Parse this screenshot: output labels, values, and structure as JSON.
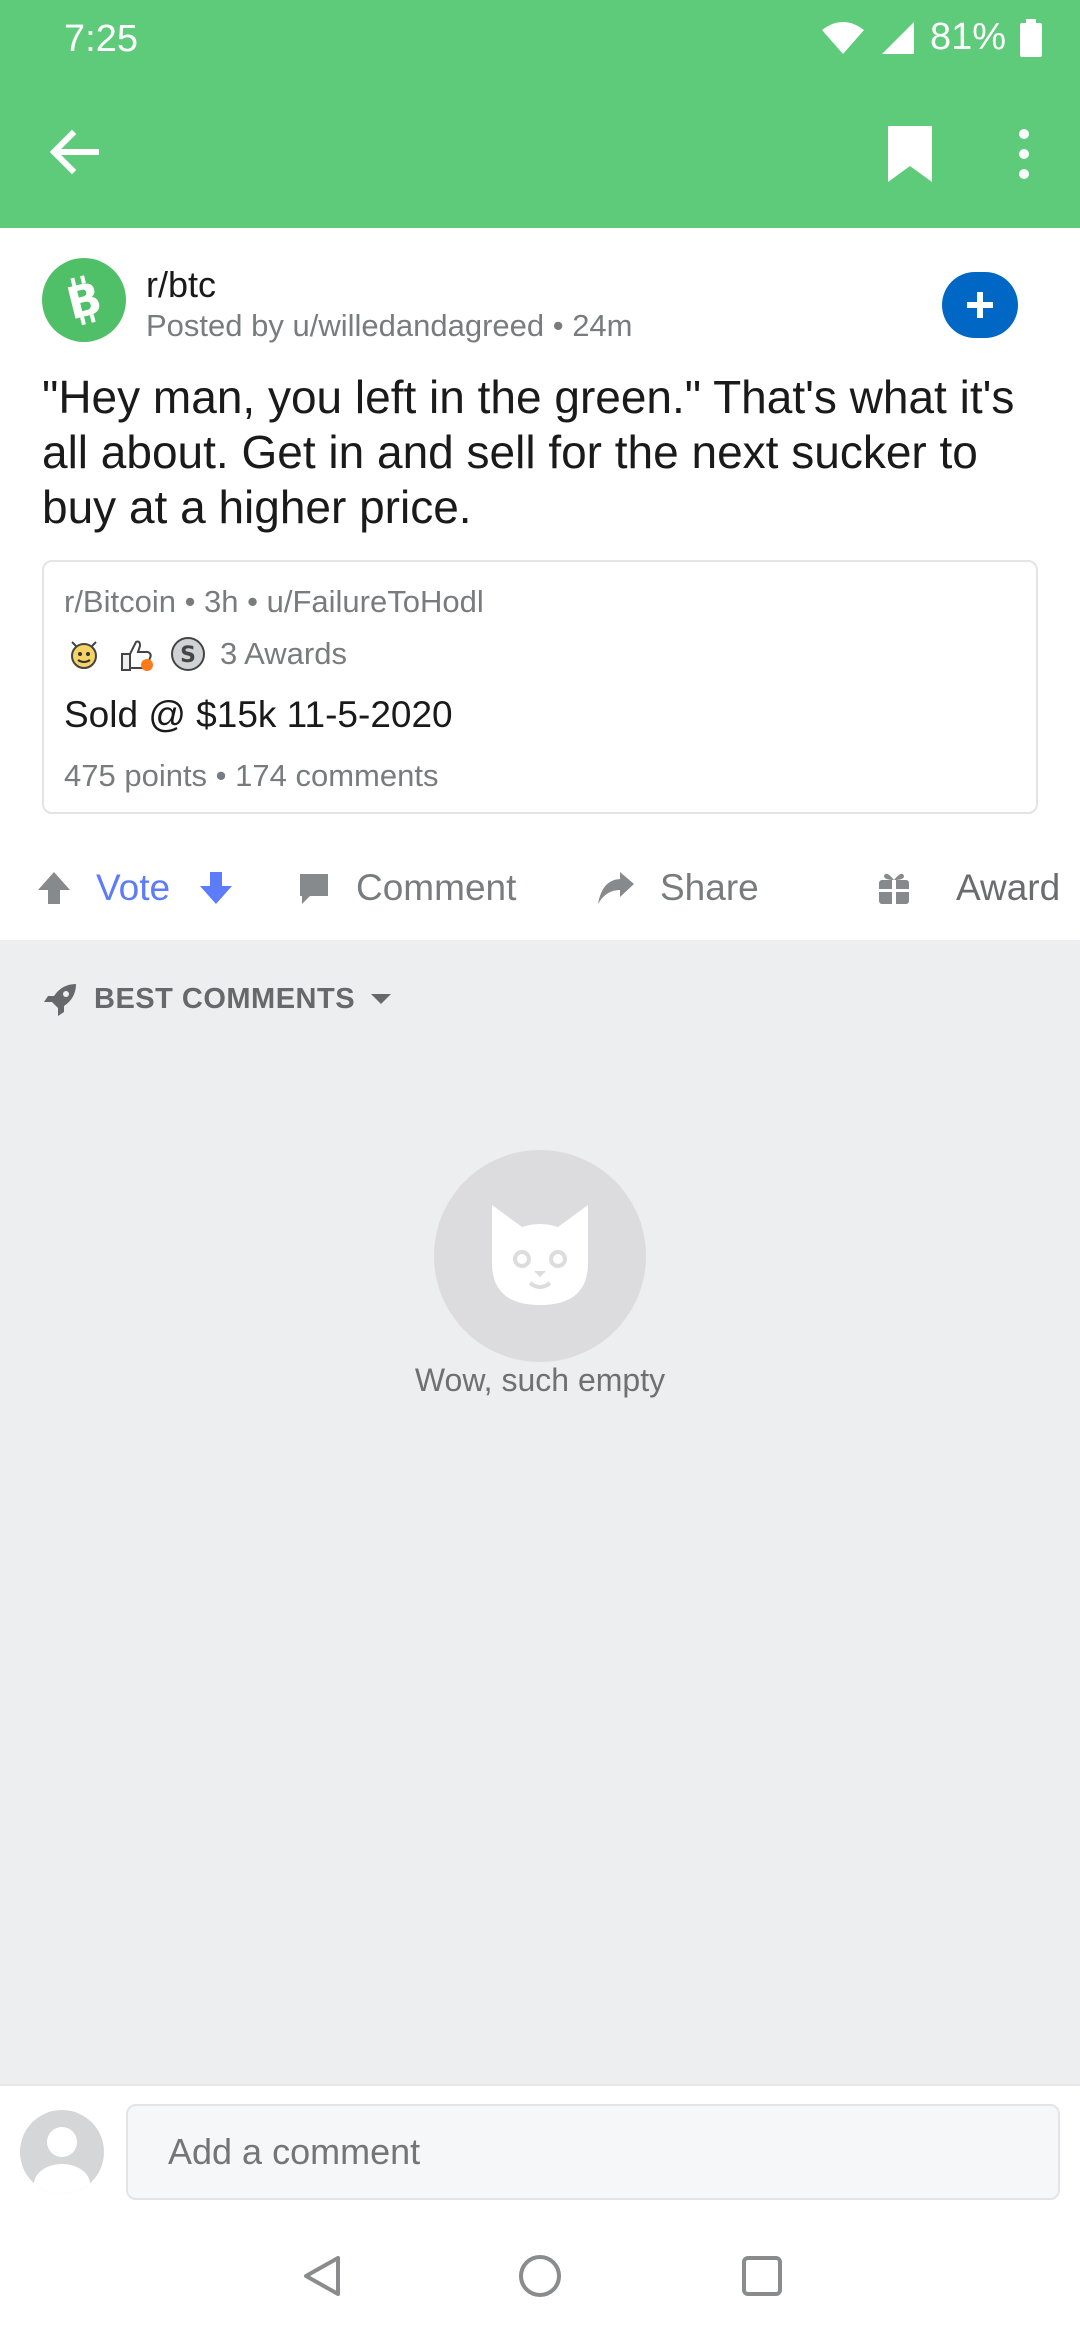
{
  "status": {
    "time": "7:25",
    "battery": "81%"
  },
  "post": {
    "subreddit": "r/btc",
    "posted_by": "Posted by u/willedandagreed • 24m",
    "title": "\"Hey man, you left in the green.\" That's what it's all about. Get in and sell for the next sucker to buy at a higher price.",
    "crosspost": {
      "meta": "r/Bitcoin • 3h • u/FailureToHodl",
      "awards_label": "3 Awards",
      "title": "Sold @ $15k 11-5-2020",
      "stats": "475 points • 174 comments"
    },
    "actions": {
      "vote": "Vote",
      "comment": "Comment",
      "share": "Share",
      "award": "Award"
    }
  },
  "comments": {
    "sort_label": "BEST COMMENTS",
    "empty_text": "Wow, such empty"
  },
  "compose": {
    "placeholder": "Add a comment"
  },
  "colors": {
    "header": "#5ecb7a",
    "vote_blue": "#5c7cfa",
    "join_blue": "#0067c5"
  },
  "icons": [
    "back-arrow-icon",
    "bookmark-icon",
    "more-vert-icon",
    "bitcoin-cash-icon",
    "plus-icon",
    "upvote-icon",
    "downvote-icon",
    "comment-icon",
    "share-icon",
    "gift-icon",
    "rocket-icon",
    "chevron-down-icon",
    "cat-icon",
    "user-avatar-icon"
  ]
}
